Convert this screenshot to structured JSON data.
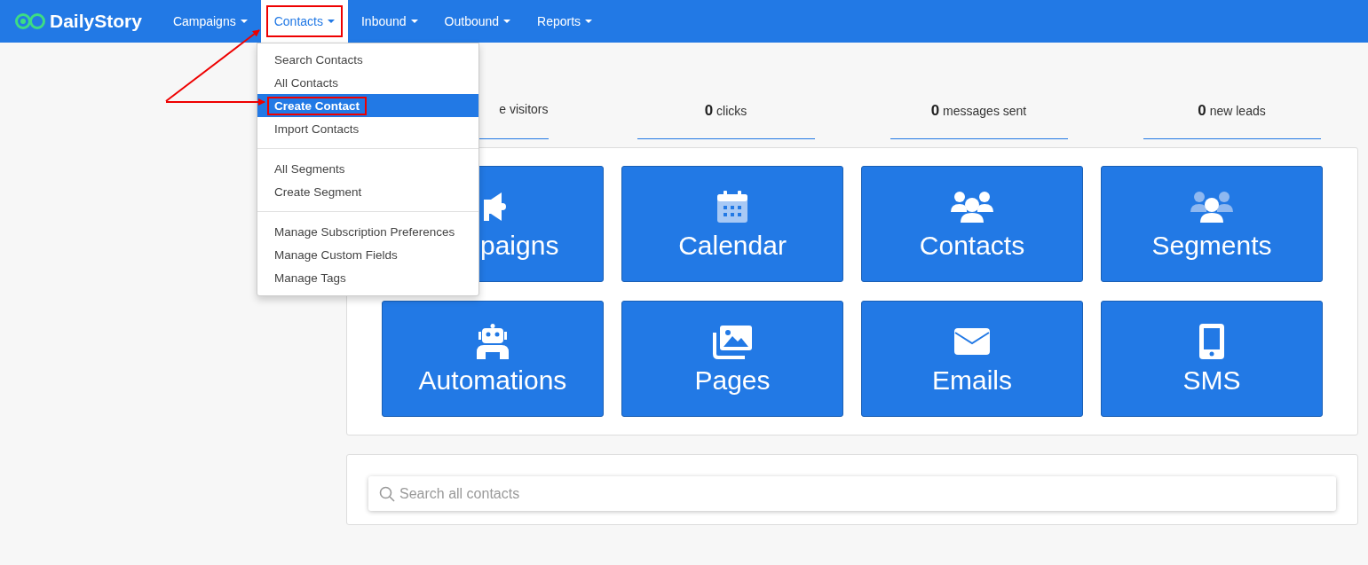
{
  "brand": "DailyStory",
  "nav": [
    {
      "label": "Campaigns",
      "selected": false,
      "highlighted": false
    },
    {
      "label": "Contacts",
      "selected": true,
      "highlighted": true
    },
    {
      "label": "Inbound",
      "selected": false,
      "highlighted": false
    },
    {
      "label": "Outbound",
      "selected": false,
      "highlighted": false
    },
    {
      "label": "Reports",
      "selected": false,
      "highlighted": false
    }
  ],
  "dropdown": {
    "groups": [
      [
        {
          "label": "Search Contacts",
          "selected": false,
          "highlighted": false
        },
        {
          "label": "All Contacts",
          "selected": false,
          "highlighted": false
        },
        {
          "label": "Create Contact",
          "selected": true,
          "highlighted": true
        },
        {
          "label": "Import Contacts",
          "selected": false,
          "highlighted": false
        }
      ],
      [
        {
          "label": "All Segments",
          "selected": false,
          "highlighted": false
        },
        {
          "label": "Create Segment",
          "selected": false,
          "highlighted": false
        }
      ],
      [
        {
          "label": "Manage Subscription Preferences",
          "selected": false,
          "highlighted": false
        },
        {
          "label": "Manage Custom Fields",
          "selected": false,
          "highlighted": false
        },
        {
          "label": "Manage Tags",
          "selected": false,
          "highlighted": false
        }
      ]
    ]
  },
  "stats": [
    {
      "label": "e visitors",
      "covered": true
    },
    {
      "count": "0",
      "label": "clicks",
      "covered": false
    },
    {
      "count": "0",
      "label": "messages sent",
      "covered": false
    },
    {
      "count": "0",
      "label": "new leads",
      "covered": false
    }
  ],
  "tiles": [
    {
      "label": "paigns",
      "covered": true
    },
    {
      "label": "Calendar",
      "covered": false
    },
    {
      "label": "Contacts",
      "covered": false
    },
    {
      "label": "Segments",
      "covered": false
    },
    {
      "label": "Automations",
      "covered": false
    },
    {
      "label": "Pages",
      "covered": false
    },
    {
      "label": "Emails",
      "covered": false
    },
    {
      "label": "SMS",
      "covered": false
    }
  ],
  "search": {
    "placeholder": "Search all contacts"
  }
}
